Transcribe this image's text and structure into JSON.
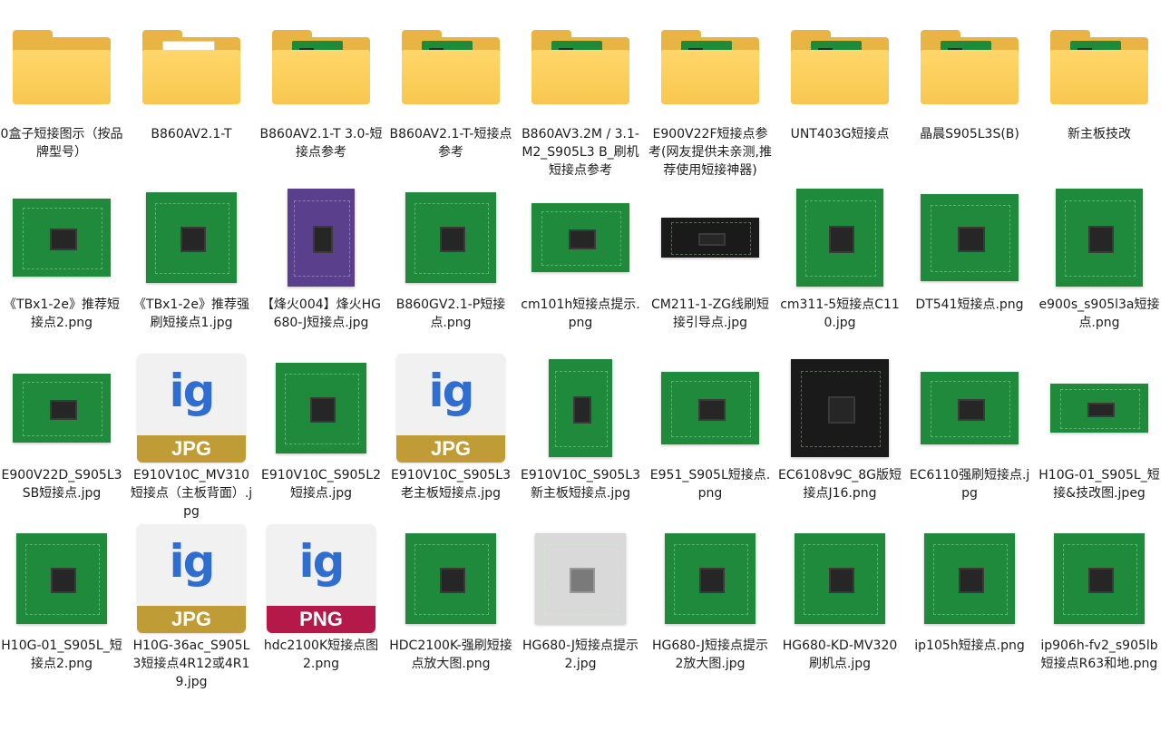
{
  "window": {
    "view": "large-icons"
  },
  "colors": {
    "folder": "#e8b443",
    "jpg_band": "#bf9c36",
    "png_band": "#b5194a",
    "pcb": "#1f8a3c"
  },
  "files": [
    {
      "label": "0盒子短接图示（按品牌型号）",
      "kind": "folder"
    },
    {
      "label": "B860AV2.1-T",
      "kind": "folder-doc"
    },
    {
      "label": "B860AV2.1-T 3.0-短接点参考",
      "kind": "folder-pcb"
    },
    {
      "label": "B860AV2.1-T-短接点参考",
      "kind": "folder-pcb"
    },
    {
      "label": "B860AV3.2M / 3.1-M2_S905L3 B_刷机短接点参考",
      "kind": "folder-pcb"
    },
    {
      "label": "E900V22F短接点参考(网友提供未亲测,推荐使用短接神器)",
      "kind": "folder-pcb"
    },
    {
      "label": "UNT403G短接点",
      "kind": "folder-pcb"
    },
    {
      "label": "晶晨S905L3S(B)",
      "kind": "folder-pcb"
    },
    {
      "label": "新主板技改",
      "kind": "folder-pcb"
    },
    {
      "label": "《TBx1-2e》推荐短接点2.png",
      "kind": "photo"
    },
    {
      "label": "《TBx1-2e》推荐强刷短接点1.jpg",
      "kind": "photo"
    },
    {
      "label": "【烽火004】烽火HG680-J短接点.jpg",
      "kind": "photo-purple"
    },
    {
      "label": "B860GV2.1-P短接点.png",
      "kind": "photo"
    },
    {
      "label": "cm101h短接点提示.png",
      "kind": "photo"
    },
    {
      "label": "CM211-1-ZG线刷短接引导点.jpg",
      "kind": "photo-black"
    },
    {
      "label": "cm311-5短接点C110.jpg",
      "kind": "photo"
    },
    {
      "label": "DT541短接点.png",
      "kind": "photo"
    },
    {
      "label": "e900s_s905l3a短接点.png",
      "kind": "photo"
    },
    {
      "label": "E900V22D_S905L3SB短接点.jpg",
      "kind": "photo"
    },
    {
      "label": "E910V10C_MV310短接点（主板背面）.jpg",
      "kind": "jpg"
    },
    {
      "label": "E910V10C_S905L2短接点.jpg",
      "kind": "photo"
    },
    {
      "label": "E910V10C_S905L3老主板短接点.jpg",
      "kind": "jpg"
    },
    {
      "label": "E910V10C_S905L3新主板短接点.jpg",
      "kind": "photo"
    },
    {
      "label": "E951_S905L短接点.png",
      "kind": "photo"
    },
    {
      "label": "EC6108v9C_8G版短接点J16.png",
      "kind": "photo-black"
    },
    {
      "label": "EC6110强刷短接点.jpg",
      "kind": "photo"
    },
    {
      "label": "H10G-01_S905L_短接&技改图.jpeg",
      "kind": "photo"
    },
    {
      "label": "H10G-01_S905L_短接点2.png",
      "kind": "photo"
    },
    {
      "label": "H10G-36ac_S905L3短接点4R12或4R19.jpg",
      "kind": "jpg"
    },
    {
      "label": "hdc2100K短接点图2.png",
      "kind": "png"
    },
    {
      "label": "HDC2100K-强刷短接点放大图.png",
      "kind": "photo"
    },
    {
      "label": "HG680-J短接点提示2.jpg",
      "kind": "photo-white"
    },
    {
      "label": "HG680-J短接点提示2放大图.jpg",
      "kind": "photo"
    },
    {
      "label": "HG680-KD-MV320刷机点.jpg",
      "kind": "photo"
    },
    {
      "label": "ip105h短接点.png",
      "kind": "photo"
    },
    {
      "label": "ip906h-fv2_s905lb短接点R63和地.png",
      "kind": "photo"
    }
  ],
  "icons": {
    "jpg_glyph": "ig",
    "jpg_band": "JPG",
    "png_glyph": "ig",
    "png_band": "PNG"
  }
}
